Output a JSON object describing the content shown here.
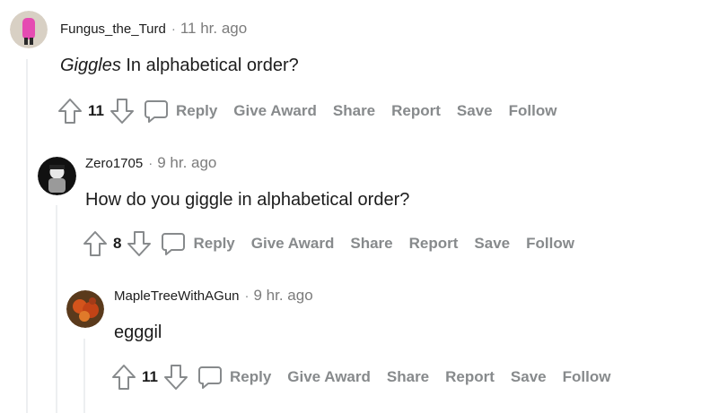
{
  "comments": [
    {
      "author": "Fungus_the_Turd",
      "sep": "·",
      "time": "11 hr. ago",
      "body_em": "Giggles",
      "body": " In alphabetical order?",
      "score": "11",
      "actions": {
        "reply": "Reply",
        "award": "Give Award",
        "share": "Share",
        "report": "Report",
        "save": "Save",
        "follow": "Follow"
      }
    },
    {
      "author": "Zero1705",
      "sep": "·",
      "time": "9 hr. ago",
      "body": "How do you giggle in alphabetical order?",
      "score": "8",
      "actions": {
        "reply": "Reply",
        "award": "Give Award",
        "share": "Share",
        "report": "Report",
        "save": "Save",
        "follow": "Follow"
      }
    },
    {
      "author": "MapleTreeWithAGun",
      "sep": "·",
      "time": "9 hr. ago",
      "body": "egggil",
      "score": "11",
      "actions": {
        "reply": "Reply",
        "award": "Give Award",
        "share": "Share",
        "report": "Report",
        "save": "Save",
        "follow": "Follow"
      }
    }
  ],
  "colors": {
    "muted": "#878a8c",
    "thread_line": "#edeff1",
    "text": "#1c1c1c"
  },
  "icons": [
    "upvote-icon",
    "downvote-icon",
    "comment-bubble-icon"
  ]
}
